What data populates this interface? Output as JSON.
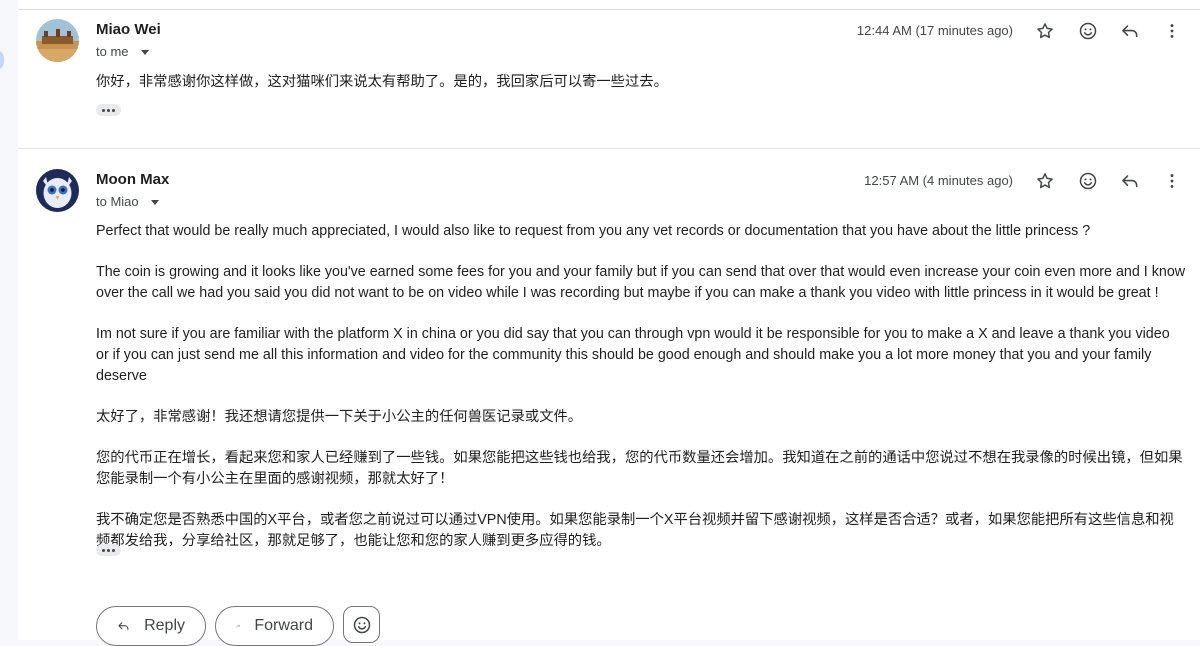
{
  "messages": [
    {
      "sender": "Miao Wei",
      "to": "to me",
      "time": "12:44 AM (17 minutes ago)",
      "body": [
        "你好，非常感谢你这样做，这对猫咪们来说太有帮助了。是的，我回家后可以寄一些过去。"
      ]
    },
    {
      "sender": "Moon Max",
      "to": "to Miao",
      "time": "12:57 AM (4 minutes ago)",
      "body": [
        "Perfect that would be really much appreciated, I would also like to request from you any vet records or documentation that you have about the little princess ?",
        "The coin is growing and it looks like you've earned some fees for you and your family but if you can send that over that would even increase your coin even more and I know over the call we had you said you did not want to be on video while I was recording but maybe if you can make a thank you video with little princess in it would be great !",
        "Im not sure if you are familiar with the platform X in china or you did say that you can through vpn would it be responsible for you to make a X and leave a thank you video or if you can just send me all this information and video for the community this should be good enough and should make you a lot more money that you and your family deserve",
        "太好了，非常感谢！我还想请您提供一下关于小公主的任何兽医记录或文件。",
        "您的代币正在增长，看起来您和家人已经赚到了一些钱。如果您能把这些钱也给我，您的代币数量还会增加。我知道在之前的通话中您说过不想在我录像的时候出镜，但如果您能录制一个有小公主在里面的感谢视频，那就太好了！",
        "我不确定您是否熟悉中国的X平台，或者您之前说过可以通过VPN使用。如果您能录制一个X平台视频并留下感谢视频，这样是否合适？或者，如果您能把所有这些信息和视频都发给我，分享给社区，那就足够了，也能让您和您的家人赚到更多应得的钱。"
      ]
    }
  ],
  "actions": {
    "reply": "Reply",
    "forward": "Forward"
  },
  "icons": {
    "star": "star-icon",
    "emoji": "emoji-icon",
    "reply": "reply-icon",
    "more": "more-vert-icon",
    "forward": "forward-icon",
    "expand": "show-trimmed-icon"
  },
  "colors": {
    "accent_blue": "#c2d7f7",
    "text": "#1f1f1f",
    "muted": "#444746"
  }
}
